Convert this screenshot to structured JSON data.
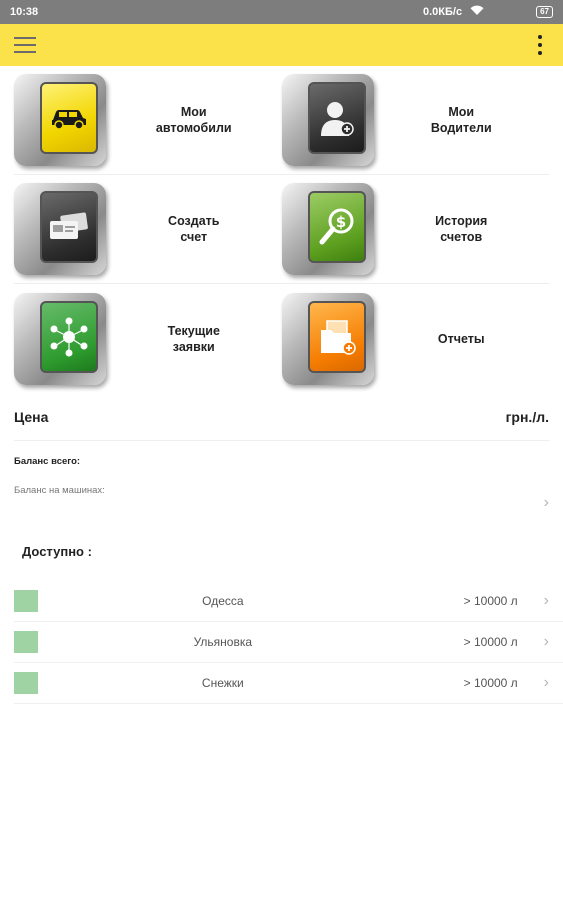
{
  "status_bar": {
    "time": "10:38",
    "speed": "0.0КБ/с",
    "battery": "67"
  },
  "app_bar": {},
  "menu": [
    {
      "label": "Мои\nавтомобили",
      "icon": "car-icon",
      "color": "yellow"
    },
    {
      "label": "Мои\nВодители",
      "icon": "driver-add-icon",
      "color": "dark"
    },
    {
      "label": "Создать\nсчет",
      "icon": "invoice-cards-icon",
      "color": "dark"
    },
    {
      "label": "История\nсчетов",
      "icon": "magnifier-dollar-icon",
      "color": "green"
    },
    {
      "label": "Текущие\nзаявки",
      "icon": "network-people-icon",
      "color": "greenb"
    },
    {
      "label": "Отчеты",
      "icon": "report-folder-icon",
      "color": "orange"
    }
  ],
  "price": {
    "label": "Цена",
    "unit": "грн./л."
  },
  "balance": {
    "total_label": "Баланс всего:",
    "cars_label": "Баланс на машинах:"
  },
  "available": {
    "title": "Доступно :",
    "swatch_color": "#9fd3a3",
    "stations": [
      {
        "name": "Одесса",
        "amount": "> 10000 л"
      },
      {
        "name": "Ульяновка",
        "amount": "> 10000 л"
      },
      {
        "name": "Снежки",
        "amount": "> 10000 л"
      }
    ]
  }
}
